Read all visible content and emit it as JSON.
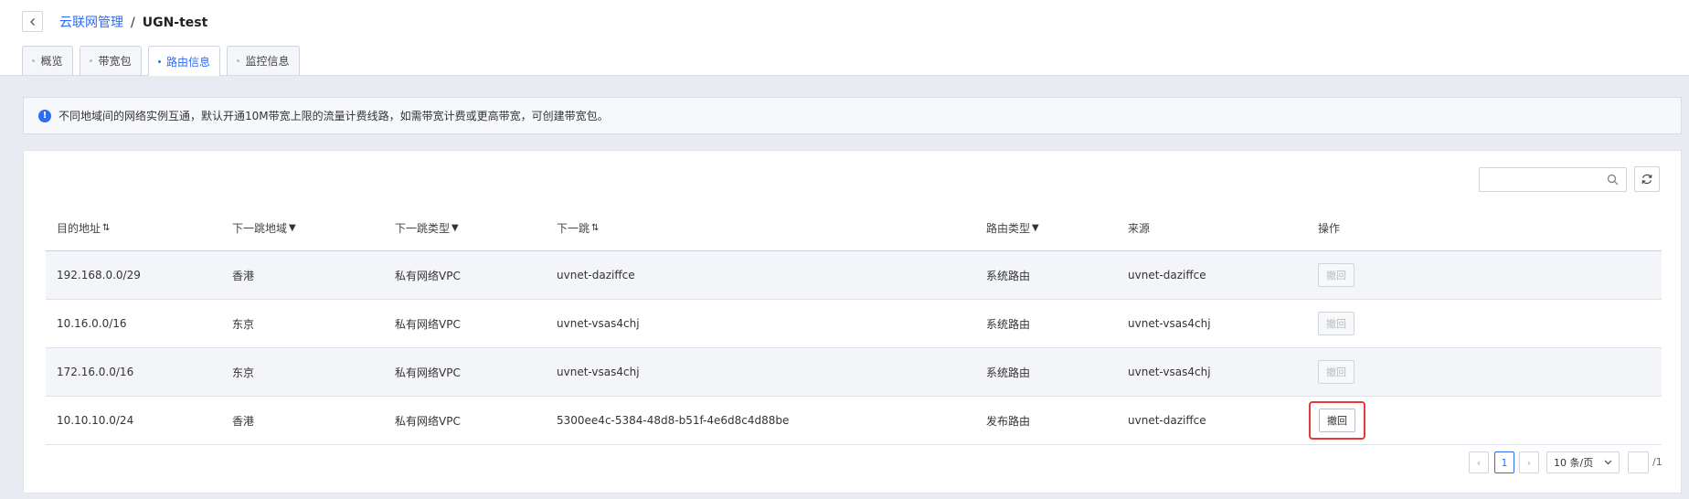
{
  "breadcrumb": {
    "parent": "云联网管理",
    "separator": "/",
    "current": "UGN-test"
  },
  "tabs": [
    {
      "label": "概览",
      "active": false
    },
    {
      "label": "带宽包",
      "active": false
    },
    {
      "label": "路由信息",
      "active": true
    },
    {
      "label": "监控信息",
      "active": false
    }
  ],
  "notice": {
    "text": "不同地域间的网络实例互通，默认开通10M带宽上限的流量计费线路，如需带宽计费或更高带宽，可创建带宽包。"
  },
  "search": {
    "value": "",
    "placeholder": ""
  },
  "table": {
    "columns": [
      "目的地址",
      "下一跳地域",
      "下一跳类型",
      "下一跳",
      "路由类型",
      "来源",
      "操作"
    ],
    "column_icons": [
      "sort",
      "filter",
      "filter",
      "sort",
      "filter",
      "",
      ""
    ],
    "rows": [
      {
        "dest": "192.168.0.0/29",
        "region": "香港",
        "hop_type": "私有网络VPC",
        "next_hop": "uvnet-daziffce",
        "route_type": "系统路由",
        "source": "uvnet-daziffce",
        "action": "撤回",
        "action_enabled": false
      },
      {
        "dest": "10.16.0.0/16",
        "region": "东京",
        "hop_type": "私有网络VPC",
        "next_hop": "uvnet-vsas4chj",
        "route_type": "系统路由",
        "source": "uvnet-vsas4chj",
        "action": "撤回",
        "action_enabled": false
      },
      {
        "dest": "172.16.0.0/16",
        "region": "东京",
        "hop_type": "私有网络VPC",
        "next_hop": "uvnet-vsas4chj",
        "route_type": "系统路由",
        "source": "uvnet-vsas4chj",
        "action": "撤回",
        "action_enabled": false
      },
      {
        "dest": "10.10.10.0/24",
        "region": "香港",
        "hop_type": "私有网络VPC",
        "next_hop": "5300ee4c-5384-48d8-b51f-4e6d8c4d88be",
        "route_type": "发布路由",
        "source": "uvnet-daziffce",
        "action": "撤回",
        "action_enabled": true,
        "highlighted": true
      }
    ]
  },
  "pagination": {
    "prev": "‹",
    "next": "›",
    "current_page": "1",
    "page_size": "10 条/页",
    "jump_value": "",
    "total": "/1"
  },
  "colors": {
    "accent": "#2f6cf6",
    "highlight": "#e53a3a",
    "background": "#e9ebf3"
  }
}
